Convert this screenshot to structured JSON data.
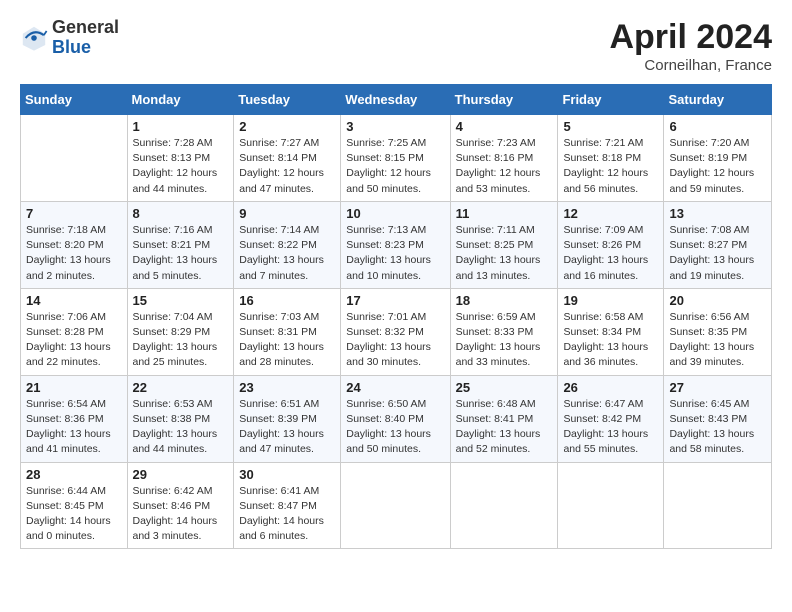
{
  "logo": {
    "general": "General",
    "blue": "Blue"
  },
  "title": {
    "month_year": "April 2024",
    "location": "Corneilhan, France"
  },
  "days_of_week": [
    "Sunday",
    "Monday",
    "Tuesday",
    "Wednesday",
    "Thursday",
    "Friday",
    "Saturday"
  ],
  "weeks": [
    [
      {
        "day": "",
        "info": ""
      },
      {
        "day": "1",
        "info": "Sunrise: 7:28 AM\nSunset: 8:13 PM\nDaylight: 12 hours\nand 44 minutes."
      },
      {
        "day": "2",
        "info": "Sunrise: 7:27 AM\nSunset: 8:14 PM\nDaylight: 12 hours\nand 47 minutes."
      },
      {
        "day": "3",
        "info": "Sunrise: 7:25 AM\nSunset: 8:15 PM\nDaylight: 12 hours\nand 50 minutes."
      },
      {
        "day": "4",
        "info": "Sunrise: 7:23 AM\nSunset: 8:16 PM\nDaylight: 12 hours\nand 53 minutes."
      },
      {
        "day": "5",
        "info": "Sunrise: 7:21 AM\nSunset: 8:18 PM\nDaylight: 12 hours\nand 56 minutes."
      },
      {
        "day": "6",
        "info": "Sunrise: 7:20 AM\nSunset: 8:19 PM\nDaylight: 12 hours\nand 59 minutes."
      }
    ],
    [
      {
        "day": "7",
        "info": "Sunrise: 7:18 AM\nSunset: 8:20 PM\nDaylight: 13 hours\nand 2 minutes."
      },
      {
        "day": "8",
        "info": "Sunrise: 7:16 AM\nSunset: 8:21 PM\nDaylight: 13 hours\nand 5 minutes."
      },
      {
        "day": "9",
        "info": "Sunrise: 7:14 AM\nSunset: 8:22 PM\nDaylight: 13 hours\nand 7 minutes."
      },
      {
        "day": "10",
        "info": "Sunrise: 7:13 AM\nSunset: 8:23 PM\nDaylight: 13 hours\nand 10 minutes."
      },
      {
        "day": "11",
        "info": "Sunrise: 7:11 AM\nSunset: 8:25 PM\nDaylight: 13 hours\nand 13 minutes."
      },
      {
        "day": "12",
        "info": "Sunrise: 7:09 AM\nSunset: 8:26 PM\nDaylight: 13 hours\nand 16 minutes."
      },
      {
        "day": "13",
        "info": "Sunrise: 7:08 AM\nSunset: 8:27 PM\nDaylight: 13 hours\nand 19 minutes."
      }
    ],
    [
      {
        "day": "14",
        "info": "Sunrise: 7:06 AM\nSunset: 8:28 PM\nDaylight: 13 hours\nand 22 minutes."
      },
      {
        "day": "15",
        "info": "Sunrise: 7:04 AM\nSunset: 8:29 PM\nDaylight: 13 hours\nand 25 minutes."
      },
      {
        "day": "16",
        "info": "Sunrise: 7:03 AM\nSunset: 8:31 PM\nDaylight: 13 hours\nand 28 minutes."
      },
      {
        "day": "17",
        "info": "Sunrise: 7:01 AM\nSunset: 8:32 PM\nDaylight: 13 hours\nand 30 minutes."
      },
      {
        "day": "18",
        "info": "Sunrise: 6:59 AM\nSunset: 8:33 PM\nDaylight: 13 hours\nand 33 minutes."
      },
      {
        "day": "19",
        "info": "Sunrise: 6:58 AM\nSunset: 8:34 PM\nDaylight: 13 hours\nand 36 minutes."
      },
      {
        "day": "20",
        "info": "Sunrise: 6:56 AM\nSunset: 8:35 PM\nDaylight: 13 hours\nand 39 minutes."
      }
    ],
    [
      {
        "day": "21",
        "info": "Sunrise: 6:54 AM\nSunset: 8:36 PM\nDaylight: 13 hours\nand 41 minutes."
      },
      {
        "day": "22",
        "info": "Sunrise: 6:53 AM\nSunset: 8:38 PM\nDaylight: 13 hours\nand 44 minutes."
      },
      {
        "day": "23",
        "info": "Sunrise: 6:51 AM\nSunset: 8:39 PM\nDaylight: 13 hours\nand 47 minutes."
      },
      {
        "day": "24",
        "info": "Sunrise: 6:50 AM\nSunset: 8:40 PM\nDaylight: 13 hours\nand 50 minutes."
      },
      {
        "day": "25",
        "info": "Sunrise: 6:48 AM\nSunset: 8:41 PM\nDaylight: 13 hours\nand 52 minutes."
      },
      {
        "day": "26",
        "info": "Sunrise: 6:47 AM\nSunset: 8:42 PM\nDaylight: 13 hours\nand 55 minutes."
      },
      {
        "day": "27",
        "info": "Sunrise: 6:45 AM\nSunset: 8:43 PM\nDaylight: 13 hours\nand 58 minutes."
      }
    ],
    [
      {
        "day": "28",
        "info": "Sunrise: 6:44 AM\nSunset: 8:45 PM\nDaylight: 14 hours\nand 0 minutes."
      },
      {
        "day": "29",
        "info": "Sunrise: 6:42 AM\nSunset: 8:46 PM\nDaylight: 14 hours\nand 3 minutes."
      },
      {
        "day": "30",
        "info": "Sunrise: 6:41 AM\nSunset: 8:47 PM\nDaylight: 14 hours\nand 6 minutes."
      },
      {
        "day": "",
        "info": ""
      },
      {
        "day": "",
        "info": ""
      },
      {
        "day": "",
        "info": ""
      },
      {
        "day": "",
        "info": ""
      }
    ]
  ]
}
